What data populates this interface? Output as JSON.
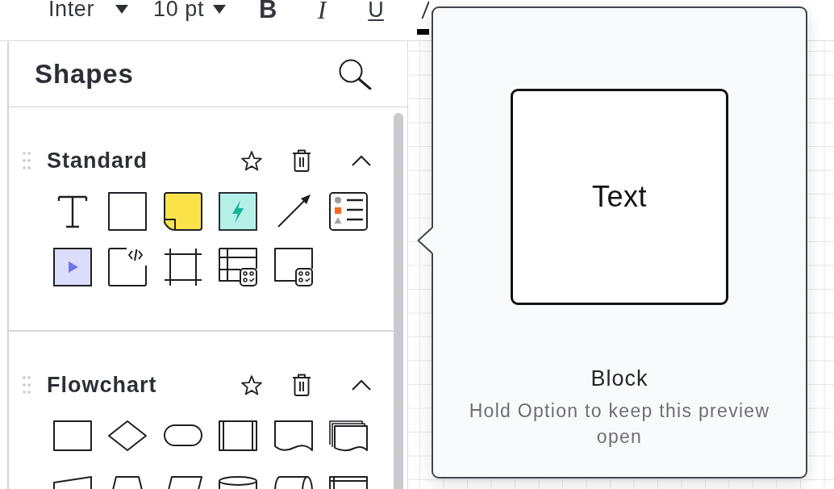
{
  "toolbar": {
    "font_family": "Inter",
    "font_size": "10 pt",
    "format_buttons": [
      {
        "kind": "bold",
        "label": "B"
      },
      {
        "kind": "italic",
        "label": "I"
      },
      {
        "kind": "underline",
        "label": "U"
      }
    ]
  },
  "shapes_panel": {
    "title": "Shapes",
    "sections": [
      {
        "kind": "standard",
        "title": "Standard",
        "expanded": true
      },
      {
        "kind": "flowchart",
        "title": "Flowchart",
        "expanded": true
      }
    ]
  },
  "preview_popover": {
    "preview_text": "Text",
    "title": "Block",
    "hint": "Hold Option to keep this preview open"
  }
}
